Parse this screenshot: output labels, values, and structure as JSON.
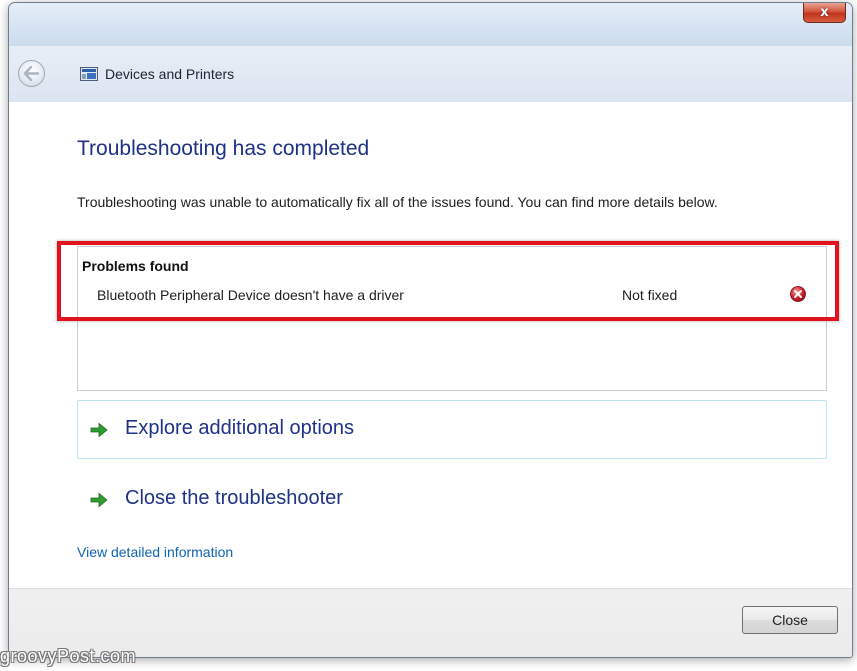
{
  "window": {
    "close_glyph": "x"
  },
  "nav": {
    "title": "Devices and Printers"
  },
  "main": {
    "heading": "Troubleshooting has completed",
    "description": "Troubleshooting was unable to automatically fix all of the issues found. You can find more details below.",
    "problems": {
      "title": "Problems found",
      "items": [
        {
          "description": "Bluetooth Peripheral Device doesn't have a driver",
          "status": "Not fixed",
          "status_icon": "error-icon"
        }
      ]
    },
    "options": [
      {
        "label": "Explore additional options",
        "icon": "green-arrow-icon"
      },
      {
        "label": "Close the troubleshooter",
        "icon": "green-arrow-icon"
      }
    ],
    "details_link": "View detailed information"
  },
  "footer": {
    "close_label": "Close"
  },
  "watermark": "groovyPost.com",
  "colors": {
    "heading": "#1e3287",
    "link": "#0f64b4",
    "highlight": "#e0121b",
    "arrow": "#2e9b2e",
    "error": "#d0202c"
  }
}
